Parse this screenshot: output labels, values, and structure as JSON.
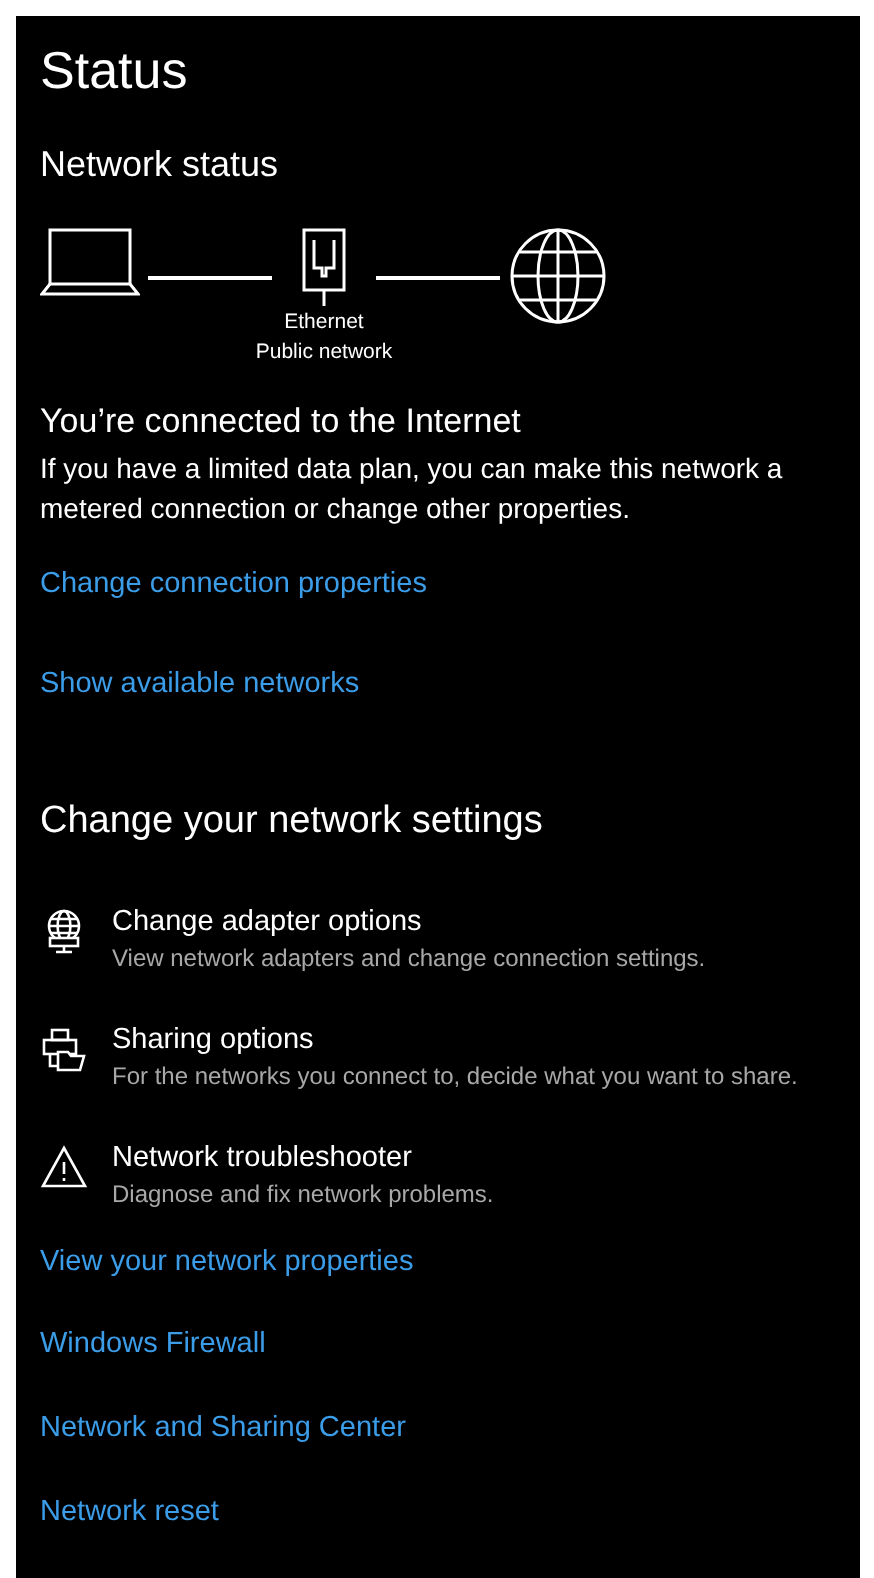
{
  "title": "Status",
  "network_status": {
    "heading": "Network status",
    "adapter_name": "Ethernet",
    "network_type": "Public network"
  },
  "connection": {
    "heading": "You’re connected to the Internet",
    "description": "If you have a limited data plan, you can make this network a metered connection or change other properties."
  },
  "top_links": [
    "Change connection properties",
    "Show available networks"
  ],
  "settings": {
    "heading": "Change your network settings",
    "options": [
      {
        "kind": "adapter",
        "title": "Change adapter options",
        "description": "View network adapters and change connection settings."
      },
      {
        "kind": "sharing",
        "title": "Sharing options",
        "description": "For the networks you connect to, decide what you want to share."
      },
      {
        "kind": "troubleshoot",
        "title": "Network troubleshooter",
        "description": "Diagnose and fix network problems."
      }
    ]
  },
  "bottom_links": [
    "View your network properties",
    "Windows Firewall",
    "Network and Sharing Center",
    "Network reset"
  ]
}
